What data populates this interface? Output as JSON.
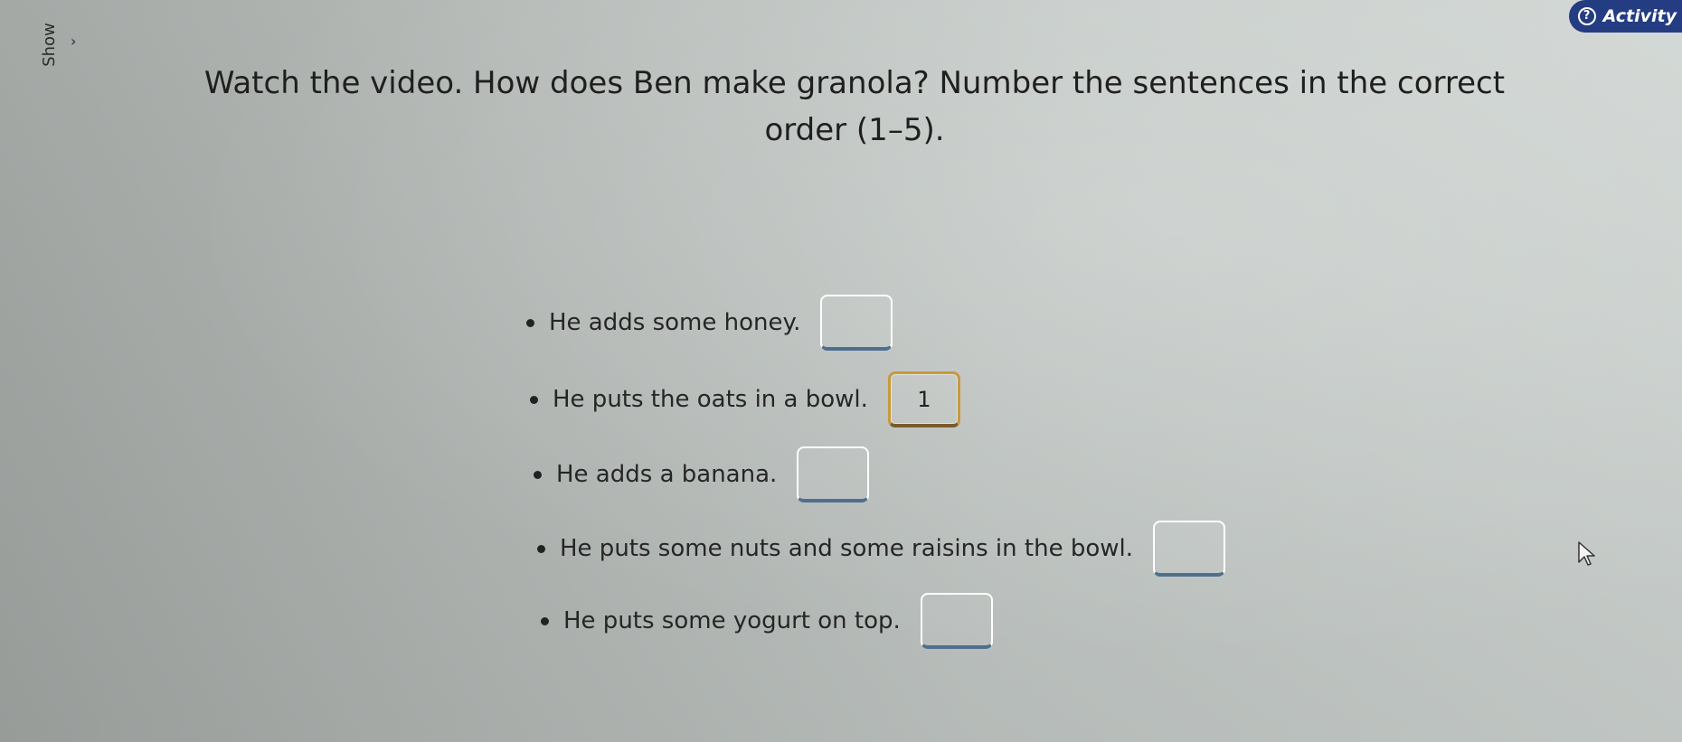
{
  "sidebar": {
    "show_label": "Show",
    "chevron_glyph": "›"
  },
  "header": {
    "activity_label": "Activity",
    "activity_icon_glyph": "?"
  },
  "instruction": {
    "text": "Watch the video. How does Ben make granola? Number the sentences in the correct order (1–5)."
  },
  "items": [
    {
      "text": "He adds some honey.",
      "value": ""
    },
    {
      "text": "He puts the oats in a bowl.",
      "value": "1"
    },
    {
      "text": "He adds a banana.",
      "value": ""
    },
    {
      "text": "He puts some nuts and some raisins in the bowl.",
      "value": ""
    },
    {
      "text": "He puts some yogurt on top.",
      "value": ""
    }
  ],
  "colors": {
    "activity_bg": "#243c82",
    "active_border": "#c79a3d"
  }
}
